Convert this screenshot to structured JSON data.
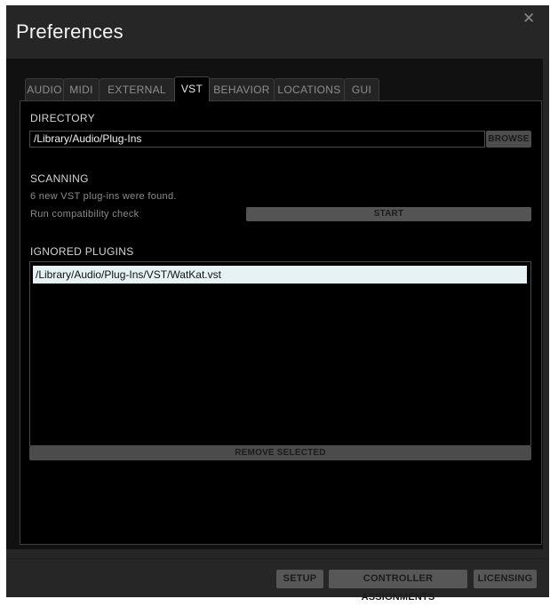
{
  "window": {
    "title": "Preferences",
    "close_icon": "close-icon"
  },
  "tabs": [
    {
      "label": "AUDIO",
      "active": false
    },
    {
      "label": "MIDI",
      "active": false
    },
    {
      "label": "EXTERNAL",
      "active": false
    },
    {
      "label": "VST",
      "active": true
    },
    {
      "label": "BEHAVIOR",
      "active": false
    },
    {
      "label": "LOCATIONS",
      "active": false
    },
    {
      "label": "GUI",
      "active": false
    }
  ],
  "directory": {
    "heading": "DIRECTORY",
    "value": "/Library/Audio/Plug-Ins",
    "browse_label": "BROWSE"
  },
  "scanning": {
    "heading": "SCANNING",
    "status": "6 new VST plug-ins were found.",
    "check_label": "Run compatibility check",
    "start_label": "START"
  },
  "ignored": {
    "heading": "IGNORED PLUGINS",
    "items": [
      "/Library/Audio/Plug-Ins/VST/WatKat.vst"
    ],
    "remove_label": "REMOVE SELECTED"
  },
  "footer": {
    "setup_label": "SETUP",
    "controller_label": "CONTROLLER ASSIGNMENTS",
    "licensing_label": "LICENSING"
  },
  "colors": {
    "dialog_bg": "#262626",
    "panel_bg": "#000000",
    "selected_row": "#e6f2f4",
    "button_bg": "#575757"
  }
}
